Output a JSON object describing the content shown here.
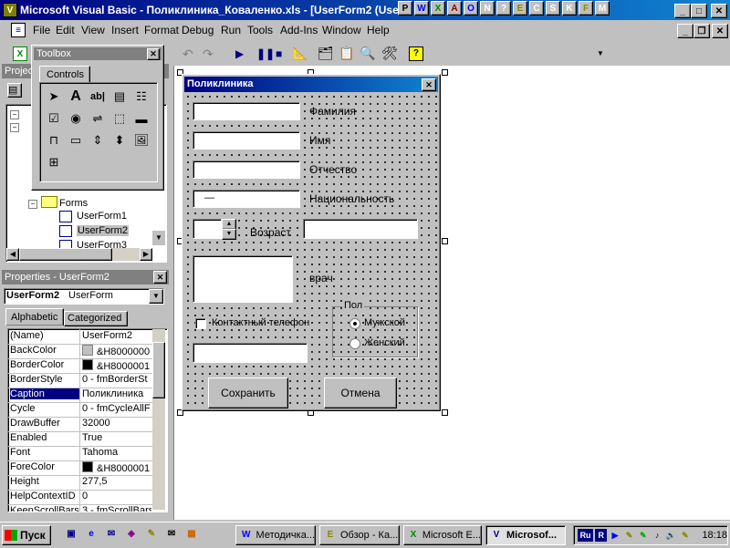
{
  "window": {
    "title": "Microsoft Visual Basic - Поликлиника_Коваленко.xls - [UserForm2 (Use",
    "min": "_",
    "max": "□",
    "close": "✕"
  },
  "top_icons": [
    "PPT",
    "W",
    "X",
    "A",
    "IE",
    "N",
    "?",
    "E",
    "C",
    "S",
    "K",
    "F",
    "P"
  ],
  "menu": [
    "File",
    "Edit",
    "View",
    "Insert",
    "Format",
    "Debug",
    "Run",
    "Tools",
    "Add-Ins",
    "Window",
    "Help"
  ],
  "toolbox": {
    "title": "Toolbox",
    "tab": "Controls",
    "tools": [
      "pointer",
      "A",
      "ab|",
      "combo",
      "list",
      "check",
      "option",
      "toggle",
      "frame",
      "button",
      "tabstrip",
      "multipage",
      "scrollbar",
      "spin",
      "image",
      "refedit"
    ]
  },
  "project": {
    "title": "Projec",
    "forms_label": "Forms",
    "items": [
      "UserForm1",
      "UserForm2",
      "UserForm3"
    ]
  },
  "properties": {
    "title": "Properties - UserForm2",
    "object": "UserForm2",
    "object_type": "UserForm",
    "tabs": [
      "Alphabetic",
      "Categorized"
    ],
    "rows": [
      {
        "name": "(Name)",
        "value": "UserForm2"
      },
      {
        "name": "BackColor",
        "value": "&H8000000",
        "swatch": "#c0c0c0"
      },
      {
        "name": "BorderColor",
        "value": "&H8000001",
        "swatch": "#000000"
      },
      {
        "name": "BorderStyle",
        "value": "0 - fmBorderSt"
      },
      {
        "name": "Caption",
        "value": "Поликлиника"
      },
      {
        "name": "Cycle",
        "value": "0 - fmCycleAllF"
      },
      {
        "name": "DrawBuffer",
        "value": "32000"
      },
      {
        "name": "Enabled",
        "value": "True"
      },
      {
        "name": "Font",
        "value": "Tahoma"
      },
      {
        "name": "ForeColor",
        "value": "&H8000001",
        "swatch": "#000000"
      },
      {
        "name": "Height",
        "value": "277,5"
      },
      {
        "name": "HelpContextID",
        "value": "0"
      },
      {
        "name": "KeepScrollBarsV",
        "value": "3 - fmScrollBars"
      }
    ]
  },
  "form": {
    "title": "Поликлиника",
    "close": "✕",
    "labels": {
      "surname": "Фамилия",
      "name": "Имя",
      "patronymic": "Отчество",
      "nationality": "Национальность",
      "age": "Возраст",
      "doctor": "врач",
      "phone_check": "Контактный телефон",
      "gender_frame": "Пол",
      "male": "Мужской",
      "female": "Женский"
    },
    "nationality_value": "—",
    "buttons": {
      "save": "Сохранить",
      "cancel": "Отмена"
    }
  },
  "taskbar": {
    "start": "Пуск",
    "tasks": [
      "Методичка...",
      "Обзор - Ка...",
      "Microsoft E...",
      "Microsof..."
    ],
    "lang": "Ru",
    "clock": "18:18"
  }
}
